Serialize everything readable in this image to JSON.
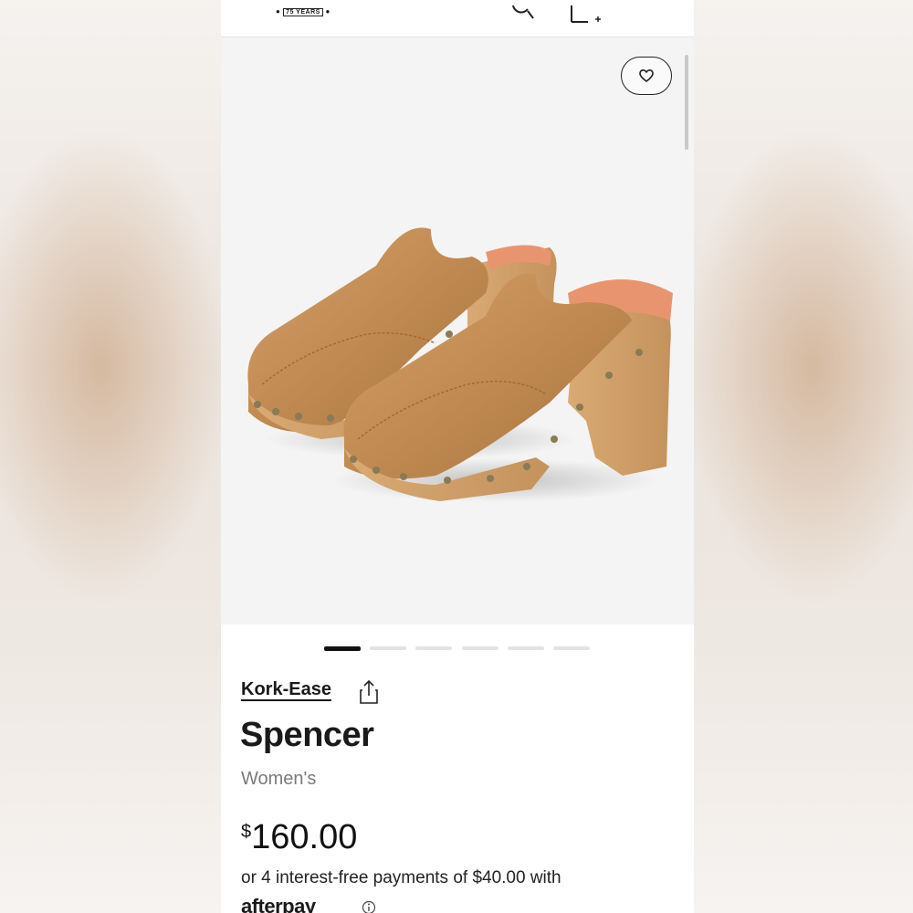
{
  "header": {
    "logo_fragment": "75 YEARS",
    "search_icon": "search-icon",
    "bag_icon": "bag-icon"
  },
  "gallery": {
    "wishlist_icon": "heart-icon",
    "image_alt": "Kork-Ease Spencer clog, tan leather with studded wooden platform",
    "slide_count": 6,
    "active_slide": 1
  },
  "product": {
    "brand": "Kork-Ease",
    "name": "Spencer",
    "gender": "Women's",
    "price_symbol": "$",
    "price_value": "160.00",
    "installments": "or 4 interest-free payments of $40.00 with",
    "afterpay_logo": "afterpay"
  },
  "colors": {
    "accent": "#111111",
    "muted_text": "#7a7a7a",
    "hero_bg": "#f4f4f4"
  }
}
